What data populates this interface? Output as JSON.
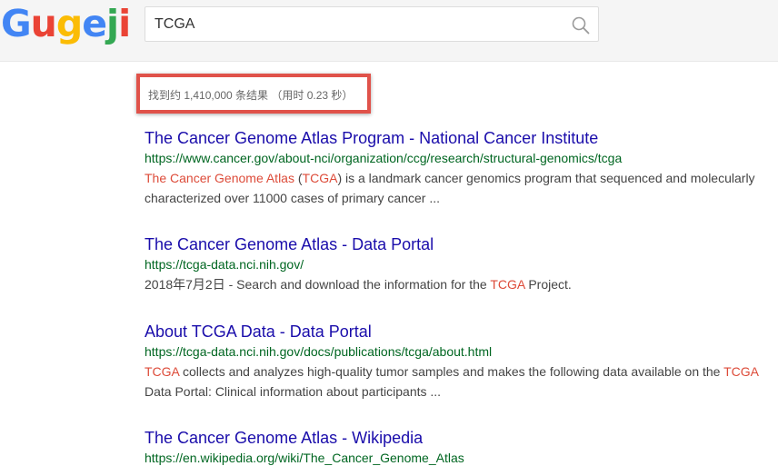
{
  "logo": {
    "letters": [
      {
        "ch": "G",
        "color": "#4285f4"
      },
      {
        "ch": "u",
        "color": "#ea4335"
      },
      {
        "ch": "g",
        "color": "#fbbc05"
      },
      {
        "ch": "e",
        "color": "#4285f4"
      },
      {
        "ch": "j",
        "color": "#34a853"
      },
      {
        "ch": "i",
        "color": "#ea4335"
      }
    ]
  },
  "search": {
    "query": "TCGA",
    "icon": "search-icon"
  },
  "stats": {
    "text": "找到约 1,410,000 条结果 （用时 0.23 秒）"
  },
  "results": [
    {
      "title": "The Cancer Genome Atlas Program - National Cancer Institute",
      "url": "https://www.cancer.gov/about-nci/organization/ccg/research/structural-genomics/tcga",
      "line1": [
        {
          "t": "The Cancer Genome Atlas",
          "hl": true
        },
        {
          "t": " (",
          "hl": false
        },
        {
          "t": "TCGA",
          "hl": true
        },
        {
          "t": ") is a landmark cancer genomics program that sequenced and molecularly",
          "hl": false
        }
      ],
      "line2": [
        {
          "t": "characterized over 11000 cases of primary cancer ...",
          "hl": false
        }
      ]
    },
    {
      "title": "The Cancer Genome Atlas - Data Portal",
      "url": "https://tcga-data.nci.nih.gov/",
      "line1": [
        {
          "t": "2018年7月2日 - Search and download the information for the ",
          "hl": false
        },
        {
          "t": "TCGA",
          "hl": true
        },
        {
          "t": " Project.",
          "hl": false
        }
      ],
      "line2": []
    },
    {
      "title": "About TCGA Data - Data Portal",
      "url": "https://tcga-data.nci.nih.gov/docs/publications/tcga/about.html",
      "line1": [
        {
          "t": "TCGA",
          "hl": true
        },
        {
          "t": " collects and analyzes high-quality tumor samples and makes the following data available on the ",
          "hl": false
        },
        {
          "t": "TCGA",
          "hl": true
        }
      ],
      "line2": [
        {
          "t": "Data Portal: Clinical information about participants ...",
          "hl": false
        }
      ]
    },
    {
      "title": "The Cancer Genome Atlas - Wikipedia",
      "url": "https://en.wikipedia.org/wiki/The_Cancer_Genome_Atlas",
      "line1": [],
      "line2": []
    }
  ],
  "colors": {
    "highlight": "#dd4b39",
    "title_link": "#1a0dab",
    "url_green": "#006621",
    "stats_border": "#e0524a"
  }
}
